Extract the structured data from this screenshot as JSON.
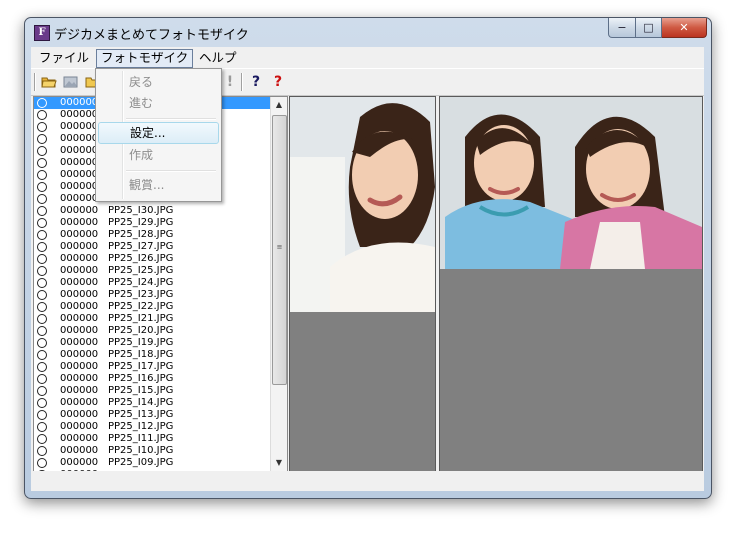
{
  "window": {
    "title": "デジカメまとめてフォトモザイク",
    "app_icon": "F",
    "controls": {
      "minimize": "−",
      "maximize": "□",
      "close": "✕"
    }
  },
  "menubar": {
    "items": [
      "ファイル",
      "フォトモザイク",
      "ヘルプ"
    ],
    "active_index": 1
  },
  "toolbar": {
    "icons": [
      "open-folder-icon",
      "image-icon",
      "folder-icon",
      "stop-icon",
      "help-icon",
      "context-help-icon"
    ],
    "help_glyph": "?",
    "stop_glyph": "!"
  },
  "dropdown": {
    "items": [
      {
        "label": "戻る",
        "enabled": false
      },
      {
        "label": "進む",
        "enabled": false
      },
      {
        "label": "設定...",
        "enabled": true,
        "highlighted": true
      },
      {
        "label": "作成",
        "enabled": false
      },
      {
        "label": "観賞...",
        "enabled": false
      }
    ]
  },
  "file_list": {
    "rows": [
      {
        "num": "000000",
        "file": ""
      },
      {
        "num": "000000",
        "file": ""
      },
      {
        "num": "000000",
        "file": ""
      },
      {
        "num": "000000",
        "file": ""
      },
      {
        "num": "000000",
        "file": ""
      },
      {
        "num": "000000",
        "file": ""
      },
      {
        "num": "000000",
        "file": ""
      },
      {
        "num": "000000",
        "file": ""
      },
      {
        "num": "000000",
        "file": ""
      },
      {
        "num": "000000",
        "file": "PP25_I30.JPG"
      },
      {
        "num": "000000",
        "file": "PP25_I29.JPG"
      },
      {
        "num": "000000",
        "file": "PP25_I28.JPG"
      },
      {
        "num": "000000",
        "file": "PP25_I27.JPG"
      },
      {
        "num": "000000",
        "file": "PP25_I26.JPG"
      },
      {
        "num": "000000",
        "file": "PP25_I25.JPG"
      },
      {
        "num": "000000",
        "file": "PP25_I24.JPG"
      },
      {
        "num": "000000",
        "file": "PP25_I23.JPG"
      },
      {
        "num": "000000",
        "file": "PP25_I22.JPG"
      },
      {
        "num": "000000",
        "file": "PP25_I21.JPG"
      },
      {
        "num": "000000",
        "file": "PP25_I20.JPG"
      },
      {
        "num": "000000",
        "file": "PP25_I19.JPG"
      },
      {
        "num": "000000",
        "file": "PP25_I18.JPG"
      },
      {
        "num": "000000",
        "file": "PP25_I17.JPG"
      },
      {
        "num": "000000",
        "file": "PP25_I16.JPG"
      },
      {
        "num": "000000",
        "file": "PP25_I15.JPG"
      },
      {
        "num": "000000",
        "file": "PP25_I14.JPG"
      },
      {
        "num": "000000",
        "file": "PP25_I13.JPG"
      },
      {
        "num": "000000",
        "file": "PP25_I12.JPG"
      },
      {
        "num": "000000",
        "file": "PP25_I11.JPG"
      },
      {
        "num": "000000",
        "file": "PP25_I10.JPG"
      },
      {
        "num": "000000",
        "file": "PP25_I09.JPG"
      },
      {
        "num": "000000",
        "file": ""
      }
    ],
    "selected_index": 0
  },
  "colors": {
    "selection": "#3399ff",
    "image_bg": "#808080",
    "wall": "#dfe4e6",
    "hair": "#3a2418",
    "skin": "#f2cdb2",
    "cardigan_blue": "#7dbde0",
    "cardigan_pink": "#d776a4"
  }
}
